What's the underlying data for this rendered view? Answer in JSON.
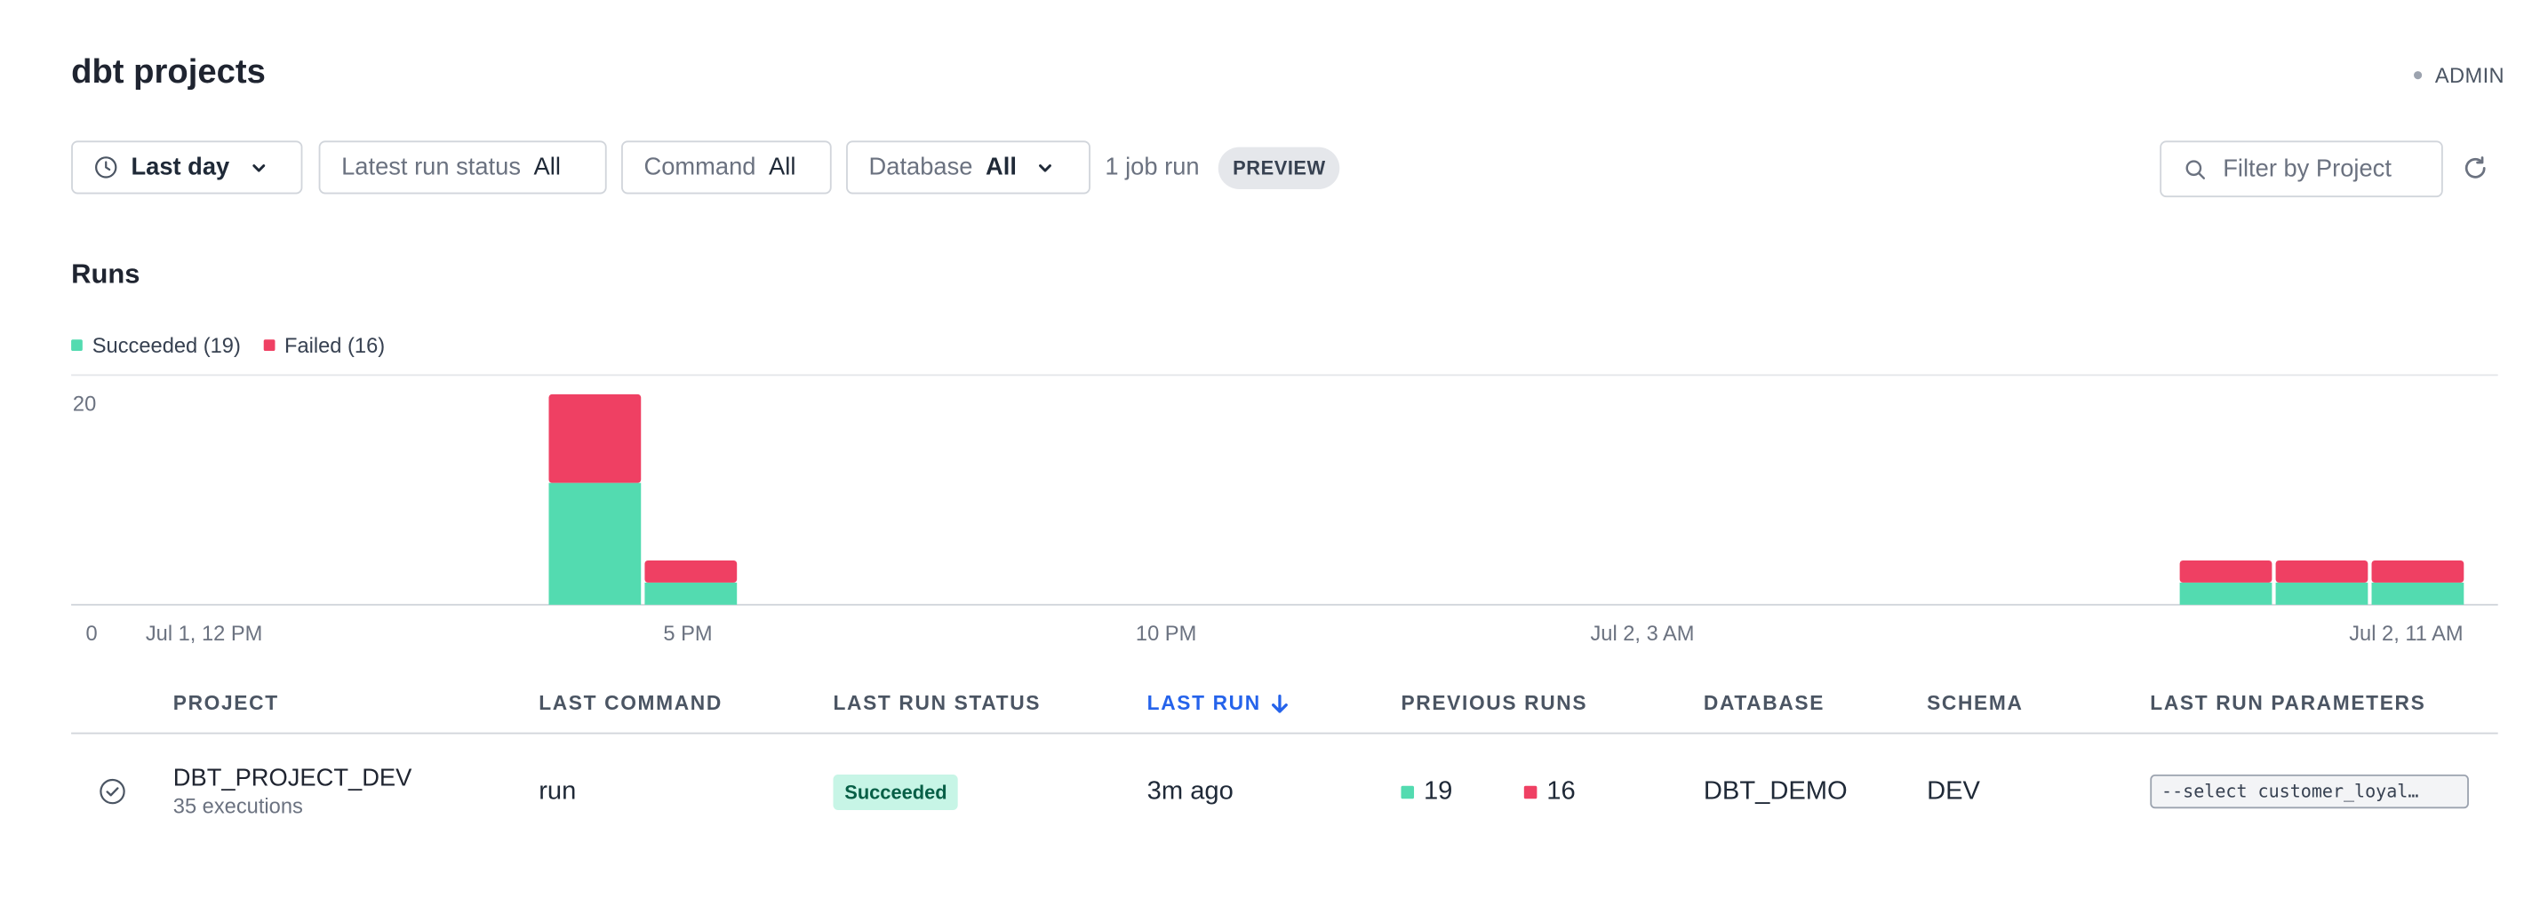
{
  "page": {
    "title": "dbt projects",
    "role": "ADMIN"
  },
  "filters": {
    "time": {
      "value": "Last day",
      "icon": "clock-icon"
    },
    "run_status": {
      "label": "Latest run status",
      "value": "All"
    },
    "command": {
      "label": "Command",
      "value": "All"
    },
    "database": {
      "label": "Database",
      "value": "All"
    },
    "job_runs": "1 job run",
    "preview_badge": "PREVIEW"
  },
  "search": {
    "placeholder": "Filter by Project"
  },
  "runs": {
    "heading": "Runs",
    "legend": {
      "succeeded": "Succeeded (19)",
      "failed": "Failed (16)"
    }
  },
  "colors": {
    "succeeded": "#53dbb0",
    "failed": "#ef4063",
    "accent": "#2563eb"
  },
  "chart_data": {
    "type": "bar",
    "stacked": true,
    "y_ticks": [
      "0",
      "20"
    ],
    "ylim": [
      0,
      20
    ],
    "x_tick_labels": [
      "Jul 1, 12 PM",
      "5 PM",
      "10 PM",
      "Jul 2, 3 AM",
      "Jul 2, 11 AM"
    ],
    "bins": [
      {
        "slot": 4,
        "succeeded": 11,
        "failed": 8
      },
      {
        "slot": 5,
        "succeeded": 2,
        "failed": 2
      },
      {
        "slot": 21,
        "succeeded": 2,
        "failed": 2
      },
      {
        "slot": 22,
        "succeeded": 2,
        "failed": 2
      },
      {
        "slot": 23,
        "succeeded": 2,
        "failed": 2
      }
    ],
    "series": [
      {
        "name": "Succeeded",
        "values": [
          11,
          2,
          2,
          2,
          2
        ]
      },
      {
        "name": "Failed",
        "values": [
          8,
          2,
          2,
          2,
          2
        ]
      }
    ]
  },
  "table": {
    "headers": [
      "PROJECT",
      "LAST COMMAND",
      "LAST RUN STATUS",
      "LAST RUN",
      "PREVIOUS RUNS",
      "DATABASE",
      "SCHEMA",
      "LAST RUN PARAMETERS"
    ],
    "rows": [
      {
        "project": "DBT_PROJECT_DEV",
        "executions": "35 executions",
        "command": "run",
        "status": "Succeeded",
        "last_run": "3m ago",
        "prev_succeeded": "19",
        "prev_failed": "16",
        "database": "DBT_DEMO",
        "schema": "DEV",
        "params": "--select customer_loyal…"
      }
    ]
  }
}
